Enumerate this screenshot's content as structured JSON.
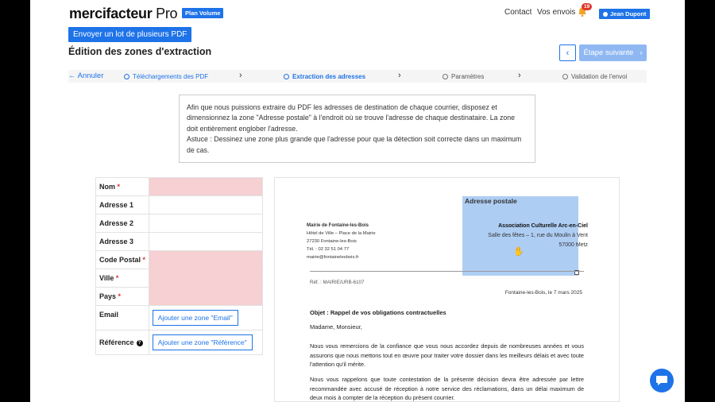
{
  "header": {
    "logo_main": "mercifacteur",
    "logo_pro": "Pro",
    "plan_badge": "Plan Volume",
    "nav_contact": "Contact",
    "nav_envois": "Vos envois",
    "notifications_count": "19",
    "user_name": "Jean Dupont"
  },
  "toolbar": {
    "batch_button": "Envoyer un lot de plusieurs PDF",
    "page_title": "Édition des zones d'extraction",
    "prev_icon": "‹",
    "next_label": "Étape suivante",
    "next_icon": "›"
  },
  "stepper": {
    "back_label": "Annuler",
    "steps": [
      {
        "label": "Téléchargements des PDF",
        "state": "done"
      },
      {
        "label": "Extraction des adresses",
        "state": "active"
      },
      {
        "label": "Paramètres",
        "state": "todo"
      },
      {
        "label": "Validation de l'envoi",
        "state": "todo"
      }
    ],
    "separator": "›"
  },
  "info": {
    "text": "Afin que nous puissions extraire du PDF les adresses de destination de chaque courrier, disposez et dimensionnez la zone \"Adresse postale\" à l'endroit où se trouve l'adresse de chaque destinataire. La zone doit entièrement englober l'adresse.",
    "tip": "Astuce : Dessinez une zone plus grande que l'adresse pour que la détection soit correcte dans un maximum de cas."
  },
  "fields": {
    "nom": "Nom",
    "adresse1": "Adresse 1",
    "adresse2": "Adresse 2",
    "adresse3": "Adresse 3",
    "code_postal": "Code Postal",
    "ville": "Ville",
    "pays": "Pays",
    "email": "Email",
    "reference": "Référence",
    "required_mark": "*",
    "email_button": "Ajouter une zone \"Email\"",
    "reference_button": "Ajouter une zone \"Référence\""
  },
  "preview": {
    "zone_label": "Adresse postale",
    "sender": {
      "name": "Mairie de Fontaine-les-Bois",
      "line1": "Hôtel de Ville – Place de la Mairie",
      "line2": "27230 Fontaine-les-Bois",
      "phone": "Tél. : 02 32 51 04 77",
      "email": "mairie@fontainelesbois.fr"
    },
    "recipient": {
      "name": "Association Culturelle Arc-en-Ciel",
      "line1": "Salle des fêtes – 1, rue du Moulin à Vent",
      "line2": "57000 Metz"
    },
    "ref": "Réf. : MAIRIE/URB-6107",
    "date": "Fontaine-les-Bois, le 7 mars 2025",
    "objet": "Objet : Rappel de vos obligations contractuelles",
    "salutation": "Madame, Monsieur,",
    "para1": "Nous vous remercions de la confiance que vous nous accordez depuis de nombreuses années et vous assurons que nous mettons tout en œuvre pour traiter votre dossier dans les meilleurs délais et avec toute l'attention qu'il mérite.",
    "para2": "Nous vous rappelons que toute contestation de la présente décision devra être adressée par lettre recommandée avec accusé de réception à notre service des réclamations, dans un délai maximum de deux mois à compter de la réception du présent courrier."
  },
  "colors": {
    "accent": "#1e73e8",
    "required_zone": "#f6d0d3",
    "extraction_zone": "#aecdf3"
  }
}
